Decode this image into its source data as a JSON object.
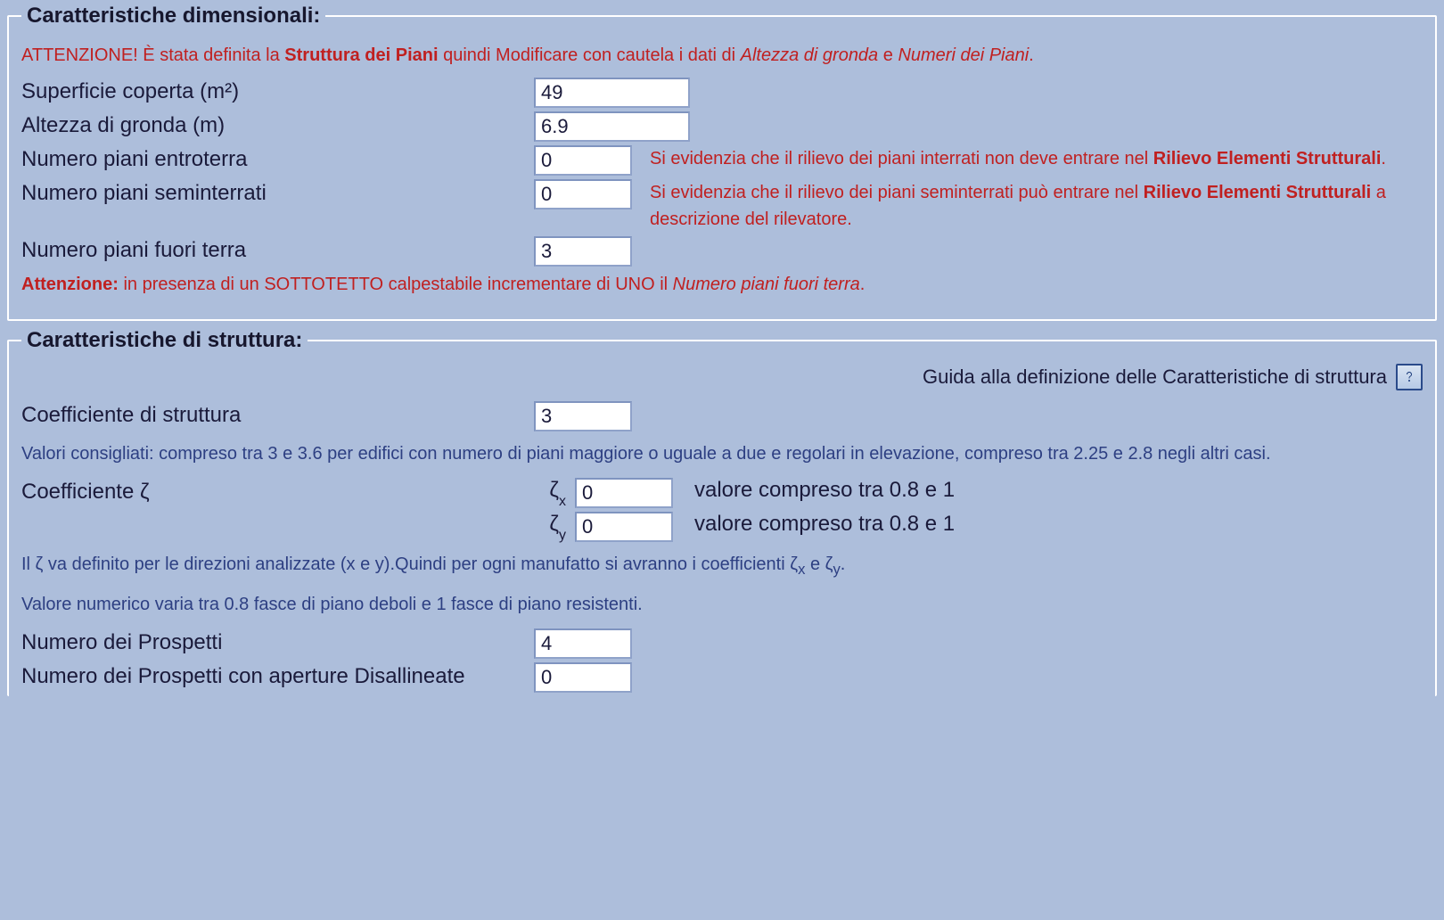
{
  "dim": {
    "legend": "Caratteristiche dimensionali:",
    "warn1_prefix": "ATTENZIONE! È stata definita la ",
    "warn1_bold": "Struttura dei Piani",
    "warn1_mid": " quindi Modificare con cautela i dati di ",
    "warn1_ital1": "Altezza di gronda",
    "warn1_e": " e ",
    "warn1_ital2": "Numeri dei Piani",
    "warn1_end": ".",
    "fields": {
      "superficie": {
        "label": "Superficie coperta (m²)",
        "value": "49"
      },
      "altezza": {
        "label": "Altezza di gronda (m)",
        "value": "6.9"
      },
      "entroterra": {
        "label": "Numero piani entroterra",
        "value": "0",
        "note_a": "Si evidenzia che il rilievo dei piani interrati non deve entrare nel ",
        "note_strong": "Rilievo Elementi Strutturali",
        "note_b": "."
      },
      "seminterrati": {
        "label": "Numero piani seminterrati",
        "value": "0",
        "note_a": "Si evidenzia che il rilievo dei piani seminterrati può entrare nel ",
        "note_strong": "Rilievo Elementi Strutturali",
        "note_b": " a descrizione del rilevatore."
      },
      "fuori_terra": {
        "label": "Numero piani fuori terra",
        "value": "3"
      }
    },
    "attenzione2_a": "Attenzione:",
    "attenzione2_b": " in presenza di un ",
    "attenzione2_c": "SOTTOTETTO",
    "attenzione2_d": " calpestabile incrementare di ",
    "attenzione2_e": "UNO",
    "attenzione2_f": " il ",
    "attenzione2_ital": "Numero piani fuori terra",
    "attenzione2_g": "."
  },
  "str": {
    "legend": "Caratteristiche di struttura:",
    "guide": "Guida alla definizione delle Caratteristiche di struttura",
    "coef_label": "Coefficiente di struttura",
    "coef_value": "3",
    "note_coef": "Valori consigliati: compreso tra 3 e 3.6 per edifici con numero di piani maggiore o uguale a due e regolari in elevazione, compreso tra 2.25 e 2.8 negli altri casi.",
    "zeta_label": "Coefficiente ζ",
    "zeta_x_prefix": "ζx",
    "zeta_x_value": "0",
    "zeta_x_hint": "valore compreso tra 0.8 e 1",
    "zeta_y_prefix": "ζy",
    "zeta_y_value": "0",
    "zeta_y_hint": "valore compreso tra 0.8 e 1",
    "note_zeta_a": "Il ζ va definito per le direzioni analizzate (x e y).Quindi per ogni manufatto si avranno i coefficienti ζ",
    "note_zeta_b": " e ζ",
    "note_zeta_c": ".",
    "note_zeta2": "Valore numerico varia tra 0.8 fasce di piano deboli e 1 fasce di piano resistenti.",
    "prospetti_label": "Numero dei Prospetti",
    "prospetti_value": "4",
    "prospetti_disal_label": "Numero dei Prospetti con aperture Disallineate",
    "prospetti_disal_value": "0"
  }
}
